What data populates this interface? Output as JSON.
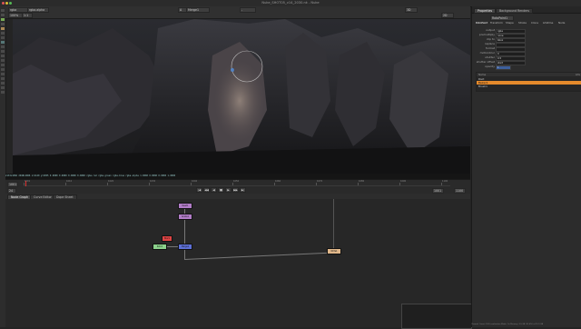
{
  "window": {
    "title": "Nuke_SHOT05_v14_2030.nk - Nuke"
  },
  "viewer_toolbar": {
    "layer": "rgba",
    "channel": "rgba.alpha",
    "a_input": "A",
    "a_node": "Merge1",
    "b_node": "-",
    "zoom": "100%",
    "proxy": "1:1",
    "mode": "3D",
    "frame_range": "2D"
  },
  "viewer": {
    "info": "2133x1066 2048x1066 x=1120 y=1055 0.0000 0.0000 0.0000 0.0000   rgba.red rgba.green rgba.blue rgba.alpha   1.0000  0.0000  0.0000  1.0000"
  },
  "timeline": {
    "ruler_labels": [
      "1001",
      "1010",
      "1020",
      "1030",
      "1040",
      "1050",
      "1060",
      "1070",
      "1080",
      "1090",
      "1100"
    ],
    "current_frame": "1001",
    "fps": "24",
    "transport_buttons": [
      "|◀",
      "◀◀",
      "◀",
      "■",
      "▶",
      "▶▶",
      "▶|"
    ],
    "in_point": "1001",
    "out_point": "1100"
  },
  "node_tabs": [
    "Node Graph",
    "Curve Editor",
    "Dope Sheet"
  ],
  "nodes": [
    {
      "label": "Read1",
      "color": "#b07cc6"
    },
    {
      "label": "Grade1",
      "color": "#b07cc6"
    },
    {
      "label": "Roto1",
      "color": "#8bd18b"
    },
    {
      "label": "Merge1",
      "color": "#5d6fd6"
    },
    {
      "label": "Blur1",
      "color": "#d44"
    },
    {
      "label": "Write1",
      "color": "#e0b78a"
    }
  ],
  "properties": {
    "tabs": [
      "Properties",
      "Background Renders"
    ],
    "node_name": "RotoPaint1",
    "sub_tabs": [
      "RotoPaint",
      "Transform",
      "Shape",
      "Stroke",
      "Clone",
      "Lifetime",
      "Node"
    ],
    "rows": [
      {
        "label": "output",
        "value": "rgba"
      },
      {
        "label": "premultiply",
        "value": "none"
      },
      {
        "label": "clip to",
        "value": "bbox"
      },
      {
        "label": "replace",
        "value": ""
      },
      {
        "label": "format",
        "value": ""
      },
      {
        "label": "motionblur",
        "value": "0"
      },
      {
        "label": "shutter",
        "value": "0.5"
      },
      {
        "label": "shutter offset",
        "value": "start"
      },
      {
        "label": "opacity",
        "value": "1"
      }
    ],
    "layer_header": [
      "Name",
      "",
      "",
      "",
      "",
      "",
      "Life"
    ],
    "layers": [
      {
        "name": "Root",
        "highlight": false
      },
      {
        "name": "Bezier1",
        "highlight": true
      },
      {
        "name": "Brush1",
        "highlight": false
      }
    ]
  },
  "statusbar": {
    "text": "Channel Count: 105 Localization Mode: On Memory: 3.5 GB (22.6%) of 15.9 GB"
  }
}
